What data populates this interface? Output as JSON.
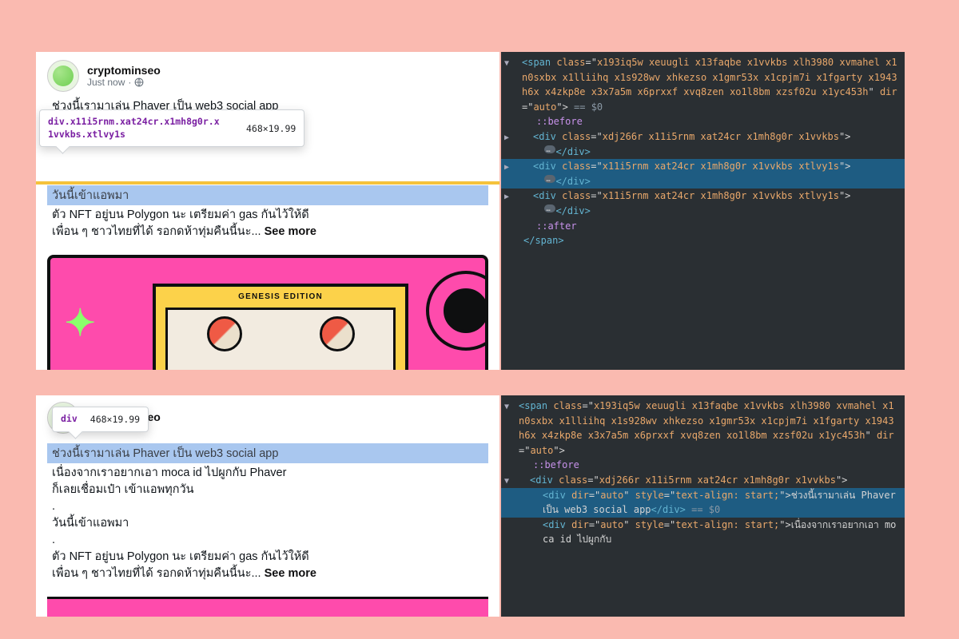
{
  "post": {
    "author": "cryptominseo",
    "timestamp": "Just now",
    "privacy_icon": "globe-icon",
    "truncated_line": "ช่วงนี้เรามาเล่น Phaver เป็น web3 social app",
    "highlighted_line": "วันนี้เข้าแอพมา",
    "body_lines_top": [
      "ตัว NFT อยู่บน Polygon นะ เตรียมค่า gas กันไว้ให้ดี",
      "เพื่อน ๆ ชาวไทยที่ได้ รอกดห้าทุ่มคืนนี้นะ..."
    ],
    "see_more": "See more",
    "genesis_title": "GENESIS EDITION"
  },
  "tooltip_top": {
    "selector": "div.x11i5rnm.xat24cr.x1mh8g0r.x1vvkbs.xtlvy1s",
    "dimensions": "468×19.99"
  },
  "post2": {
    "highlighted_line": "ช่วงนี้เรามาเล่น Phaver เป็น web3 social app",
    "body_lines": [
      "เนื่องจากเราอยากเอา moca id ไปผูกกับ Phaver",
      "ก็เลยเชื่อมเป๋า เข้าแอพทุกวัน",
      ".",
      "วันนี้เข้าแอพมา",
      ".",
      "ตัว NFT อยู่บน Polygon นะ เตรียมค่า gas กันไว้ให้ดี",
      "เพื่อน ๆ ชาวไทยที่ได้ รอกดห้าทุ่มคืนนี้นะ..."
    ]
  },
  "tooltip_bottom": {
    "selector": "div",
    "dimensions": "468×19.99"
  },
  "devtools_top": {
    "span_class": "x193iq5w xeuugli x13faqbe x1vvkbs xlh3980 xvmahel x1n0sxbx x1lliihq x1s928wv xhkezso x1gmr53x x1cpjm7i x1fgarty x1943h6x x4zkp8e x3x7a5m x6prxxf xvq8zen xo1l8bm xzsf02u x1yc453h",
    "span_dir": "auto",
    "eqsym": " == $0",
    "before": "::before",
    "div1_class": "xdj266r x11i5rnm xat24cr x1mh8g0r x1vvkbs",
    "div2_class": "x11i5rnm xat24cr x1mh8g0r x1vvkbs xtlvy1s",
    "div3_class": "x11i5rnm xat24cr x1mh8g0r x1vvkbs xtlvy1s",
    "after": "::after"
  },
  "devtools_bottom": {
    "span_class": "x193iq5w xeuugli x13faqbe x1vvkbs xlh3980 xvmahel x1n0sxbx x1lliihq x1s928wv xhkezso x1gmr53x x1cpjm7i x1fgarty x1943h6x x4zkp8e x3x7a5m x6prxxf xvq8zen xo1l8bm xzsf02u x1yc453h",
    "span_dir": "auto",
    "before": "::before",
    "div_outer_class": "xdj266r x11i5rnm xat24cr x1mh8g0r x1vvkbs",
    "inner1_attr": "dir=\"auto\" style=\"text-align: start;\"",
    "inner1_text": "ช่วงนี้เรามาเล่น Phaver เป็น web3 social app",
    "close1": "</div>",
    "eqsym": " == $0",
    "inner2_attr": "dir=\"auto\" style=\"text-align: start;\"",
    "inner2_text": "เนื่องจากเราอยากเอา moca id ไปผูกกับ"
  }
}
